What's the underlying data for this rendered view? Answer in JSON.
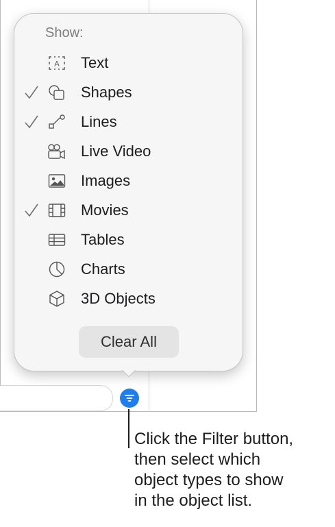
{
  "filter_menu": {
    "header": "Show:",
    "items": [
      {
        "label": "Text",
        "checked": false,
        "icon": "text-box-icon"
      },
      {
        "label": "Shapes",
        "checked": true,
        "icon": "shapes-icon"
      },
      {
        "label": "Lines",
        "checked": true,
        "icon": "line-icon"
      },
      {
        "label": "Live Video",
        "checked": false,
        "icon": "live-video-icon"
      },
      {
        "label": "Images",
        "checked": false,
        "icon": "image-icon"
      },
      {
        "label": "Movies",
        "checked": true,
        "icon": "film-icon"
      },
      {
        "label": "Tables",
        "checked": false,
        "icon": "table-icon"
      },
      {
        "label": "Charts",
        "checked": false,
        "icon": "pie-chart-icon"
      },
      {
        "label": "3D Objects",
        "checked": false,
        "icon": "cube-icon"
      }
    ],
    "clear_button_label": "Clear All"
  },
  "filter_button": {
    "icon": "filter-icon",
    "color": "#1e7ef1"
  },
  "callout": {
    "lines": [
      "Click the Filter button,",
      "then select which",
      "object types to show",
      "in the object list."
    ]
  },
  "colors": {
    "accent": "#1e7ef1",
    "popover_bg": "#f6f6f6",
    "checkmark": "#6e6e6e",
    "clear_button_bg": "#e4e4e4"
  }
}
